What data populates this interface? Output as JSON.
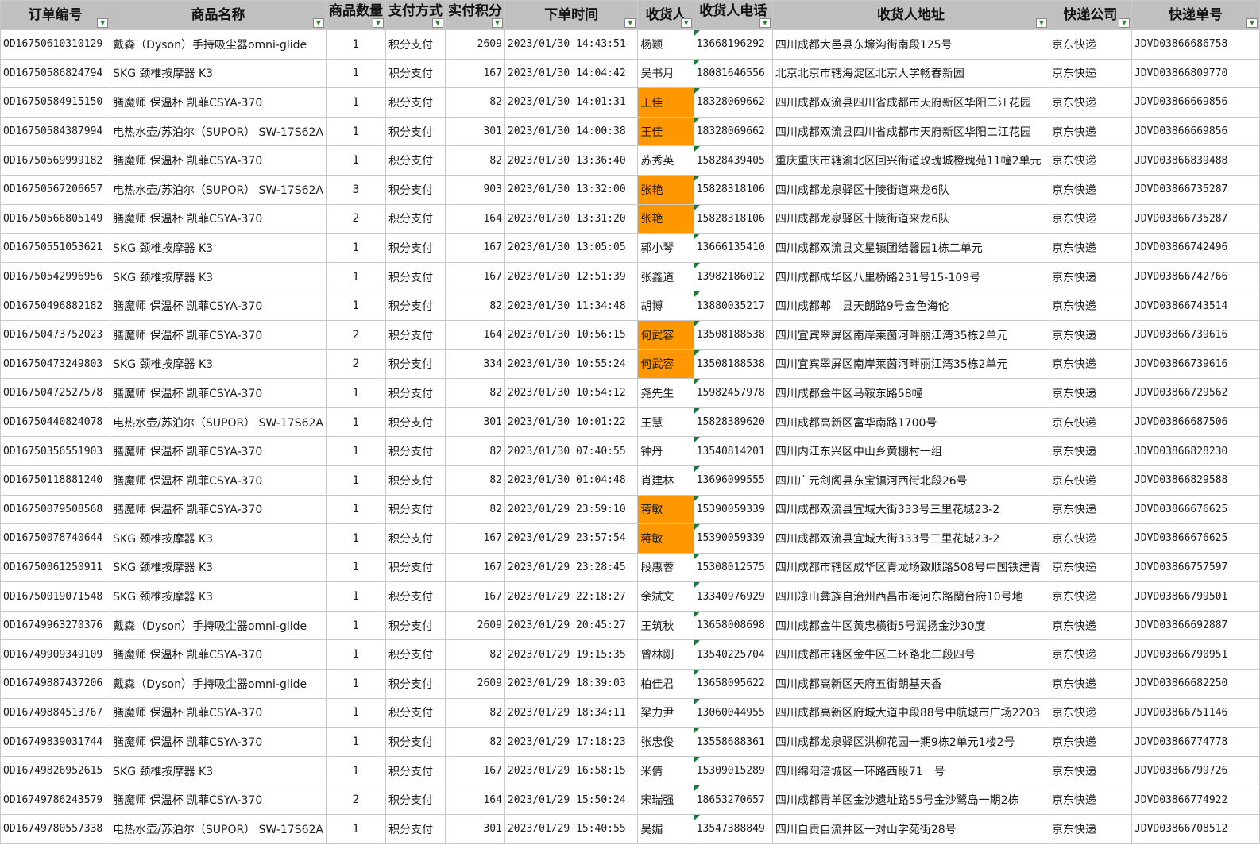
{
  "headers": [
    {
      "label": "订单编号"
    },
    {
      "label": "商品名称"
    },
    {
      "label": "商品数量"
    },
    {
      "label": "支付方式"
    },
    {
      "label": "实付积分"
    },
    {
      "label": "下单时间"
    },
    {
      "label": "收货人"
    },
    {
      "label": "收货人电话"
    },
    {
      "label": "收货人地址"
    },
    {
      "label": "快递公司"
    },
    {
      "label": "快递单号"
    }
  ],
  "highlight_color": "#ff9800",
  "comment_marker_color": "#1b7a3a",
  "filter_icon": "dropdown-filter-icon",
  "rows": [
    {
      "id": "OD16750610310129",
      "product": "戴森（Dyson）手持吸尘器omni-glide",
      "qty": "1",
      "pay": "积分支付",
      "points": "2609",
      "time": "2023/01/30 14:43:51",
      "name": "杨颖",
      "hl": false,
      "phone": "13668196292",
      "addr": "四川成都大邑县东壕沟街南段125号",
      "courier": "京东快递",
      "track": "JDVD03866686758"
    },
    {
      "id": "OD16750586824794",
      "product": "SKG 颈椎按摩器 K3",
      "qty": "1",
      "pay": "积分支付",
      "points": "167",
      "time": "2023/01/30 14:04:42",
      "name": "吴书月",
      "hl": false,
      "phone": "18081646556",
      "addr": "北京北京市辖海淀区北京大学畅春新园",
      "courier": "京东快递",
      "track": "JDVD03866809770"
    },
    {
      "id": "OD16750584915150",
      "product": "膳魔师 保温杯 凯菲CSYA-370",
      "qty": "1",
      "pay": "积分支付",
      "points": "82",
      "time": "2023/01/30 14:01:31",
      "name": "王佳",
      "hl": true,
      "phone": "18328069662",
      "addr": "四川成都双流县四川省成都市天府新区华阳二江花园",
      "courier": "京东快递",
      "track": "JDVD03866669856"
    },
    {
      "id": "OD16750584387994",
      "product": "电热水壶/苏泊尔（SUPOR） SW-17S62A",
      "qty": "1",
      "pay": "积分支付",
      "points": "301",
      "time": "2023/01/30 14:00:38",
      "name": "王佳",
      "hl": true,
      "phone": "18328069662",
      "addr": "四川成都双流县四川省成都市天府新区华阳二江花园",
      "courier": "京东快递",
      "track": "JDVD03866669856"
    },
    {
      "id": "OD16750569999182",
      "product": "膳魔师 保温杯 凯菲CSYA-370",
      "qty": "1",
      "pay": "积分支付",
      "points": "82",
      "time": "2023/01/30 13:36:40",
      "name": "苏秀英",
      "hl": false,
      "phone": "15828439405",
      "addr": "重庆重庆市辖渝北区回兴街道玫瑰城橙瑰苑11幢2单元",
      "courier": "京东快递",
      "track": "JDVD03866839488"
    },
    {
      "id": "OD16750567206657",
      "product": "电热水壶/苏泊尔（SUPOR） SW-17S62A",
      "qty": "3",
      "pay": "积分支付",
      "points": "903",
      "time": "2023/01/30 13:32:00",
      "name": "张艳",
      "hl": true,
      "phone": "15828318106",
      "addr": "四川成都龙泉驿区十陵街道来龙6队",
      "courier": "京东快递",
      "track": "JDVD03866735287"
    },
    {
      "id": "OD16750566805149",
      "product": "膳魔师 保温杯 凯菲CSYA-370",
      "qty": "2",
      "pay": "积分支付",
      "points": "164",
      "time": "2023/01/30 13:31:20",
      "name": "张艳",
      "hl": true,
      "phone": "15828318106",
      "addr": "四川成都龙泉驿区十陵街道来龙6队",
      "courier": "京东快递",
      "track": "JDVD03866735287"
    },
    {
      "id": "OD16750551053621",
      "product": "SKG 颈椎按摩器 K3",
      "qty": "1",
      "pay": "积分支付",
      "points": "167",
      "time": "2023/01/30 13:05:05",
      "name": "郭小琴",
      "hl": false,
      "phone": "13666135410",
      "addr": "四川成都双流县文星镇团结馨园1栋二单元",
      "courier": "京东快递",
      "track": "JDVD03866742496"
    },
    {
      "id": "OD16750542996956",
      "product": "SKG 颈椎按摩器 K3",
      "qty": "1",
      "pay": "积分支付",
      "points": "167",
      "time": "2023/01/30 12:51:39",
      "name": "张鑫道",
      "hl": false,
      "phone": "13982186012",
      "addr": "四川成都成华区八里桥路231号15-109号",
      "courier": "京东快递",
      "track": "JDVD03866742766"
    },
    {
      "id": "OD16750496882182",
      "product": "膳魔师 保温杯 凯菲CSYA-370",
      "qty": "1",
      "pay": "积分支付",
      "points": "82",
      "time": "2023/01/30 11:34:48",
      "name": "胡博",
      "hl": false,
      "phone": "13880035217",
      "addr": "四川成都郫　县天朗路9号金色海伦",
      "courier": "京东快递",
      "track": "JDVD03866743514"
    },
    {
      "id": "OD16750473752023",
      "product": "膳魔师 保温杯 凯菲CSYA-370",
      "qty": "2",
      "pay": "积分支付",
      "points": "164",
      "time": "2023/01/30 10:56:15",
      "name": "何武容",
      "hl": true,
      "phone": "13508188538",
      "addr": "四川宜宾翠屏区南岸莱茵河畔丽江湾35栋2单元",
      "courier": "京东快递",
      "track": "JDVD03866739616"
    },
    {
      "id": "OD16750473249803",
      "product": "SKG 颈椎按摩器 K3",
      "qty": "2",
      "pay": "积分支付",
      "points": "334",
      "time": "2023/01/30 10:55:24",
      "name": "何武容",
      "hl": true,
      "phone": "13508188538",
      "addr": "四川宜宾翠屏区南岸莱茵河畔丽江湾35栋2单元",
      "courier": "京东快递",
      "track": "JDVD03866739616"
    },
    {
      "id": "OD16750472527578",
      "product": "膳魔师 保温杯 凯菲CSYA-370",
      "qty": "1",
      "pay": "积分支付",
      "points": "82",
      "time": "2023/01/30 10:54:12",
      "name": "尧先生",
      "hl": false,
      "phone": "15982457978",
      "addr": "四川成都金牛区马鞍东路58幢",
      "courier": "京东快递",
      "track": "JDVD03866729562"
    },
    {
      "id": "OD16750440824078",
      "product": "电热水壶/苏泊尔（SUPOR） SW-17S62A",
      "qty": "1",
      "pay": "积分支付",
      "points": "301",
      "time": "2023/01/30 10:01:22",
      "name": "王慧",
      "hl": false,
      "phone": "15828389620",
      "addr": "四川成都高新区富华南路1700号",
      "courier": "京东快递",
      "track": "JDVD03866687506"
    },
    {
      "id": "OD16750356551903",
      "product": "膳魔师 保温杯 凯菲CSYA-370",
      "qty": "1",
      "pay": "积分支付",
      "points": "82",
      "time": "2023/01/30 07:40:55",
      "name": "钟丹",
      "hl": false,
      "phone": "13540814201",
      "addr": "四川内江东兴区中山乡黄棚村一组",
      "courier": "京东快递",
      "track": "JDVD03866828230"
    },
    {
      "id": "OD16750118881240",
      "product": "膳魔师 保温杯 凯菲CSYA-370",
      "qty": "1",
      "pay": "积分支付",
      "points": "82",
      "time": "2023/01/30 01:04:48",
      "name": "肖建林",
      "hl": false,
      "phone": "13696099555",
      "addr": "四川广元剑阁县东宝镇河西街北段26号",
      "courier": "京东快递",
      "track": "JDVD03866829588"
    },
    {
      "id": "OD16750079508568",
      "product": "膳魔师 保温杯 凯菲CSYA-370",
      "qty": "1",
      "pay": "积分支付",
      "points": "82",
      "time": "2023/01/29 23:59:10",
      "name": "蒋敏",
      "hl": true,
      "phone": "15390059339",
      "addr": "四川成都双流县宜城大街333号三里花城23-2",
      "courier": "京东快递",
      "track": "JDVD03866676625"
    },
    {
      "id": "OD16750078740644",
      "product": "SKG 颈椎按摩器 K3",
      "qty": "1",
      "pay": "积分支付",
      "points": "167",
      "time": "2023/01/29 23:57:54",
      "name": "蒋敏",
      "hl": true,
      "phone": "15390059339",
      "addr": "四川成都双流县宜城大街333号三里花城23-2",
      "courier": "京东快递",
      "track": "JDVD03866676625"
    },
    {
      "id": "OD16750061250911",
      "product": "SKG 颈椎按摩器 K3",
      "qty": "1",
      "pay": "积分支付",
      "points": "167",
      "time": "2023/01/29 23:28:45",
      "name": "段惠蓉",
      "hl": false,
      "phone": "15308012575",
      "addr": "四川成都市辖区成华区青龙场致顺路508号中国铁建青",
      "courier": "京东快递",
      "track": "JDVD03866757597"
    },
    {
      "id": "OD16750019071548",
      "product": "SKG 颈椎按摩器 K3",
      "qty": "1",
      "pay": "积分支付",
      "points": "167",
      "time": "2023/01/29 22:18:27",
      "name": "余斌文",
      "hl": false,
      "phone": "13340976929",
      "addr": "四川凉山彝族自治州西昌市海河东路蘭台府10号地",
      "courier": "京东快递",
      "track": "JDVD03866799501"
    },
    {
      "id": "OD16749963270376",
      "product": "戴森（Dyson）手持吸尘器omni-glide",
      "qty": "1",
      "pay": "积分支付",
      "points": "2609",
      "time": "2023/01/29 20:45:27",
      "name": "王筑秋",
      "hl": false,
      "phone": "13658008698",
      "addr": "四川成都金牛区黄忠横街5号润扬金沙30度",
      "courier": "京东快递",
      "track": "JDVD03866692887"
    },
    {
      "id": "OD16749909349109",
      "product": "膳魔师 保温杯 凯菲CSYA-370",
      "qty": "1",
      "pay": "积分支付",
      "points": "82",
      "time": "2023/01/29 19:15:35",
      "name": "曾林刚",
      "hl": false,
      "phone": "13540225704",
      "addr": "四川成都市辖区金牛区二环路北二段四号",
      "courier": "京东快递",
      "track": "JDVD03866790951"
    },
    {
      "id": "OD16749887437206",
      "product": "戴森（Dyson）手持吸尘器omni-glide",
      "qty": "1",
      "pay": "积分支付",
      "points": "2609",
      "time": "2023/01/29 18:39:03",
      "name": "柏佳君",
      "hl": false,
      "phone": "13658095622",
      "addr": "四川成都高新区天府五街朗基天香",
      "courier": "京东快递",
      "track": "JDVD03866682250"
    },
    {
      "id": "OD16749884513767",
      "product": "膳魔师 保温杯 凯菲CSYA-370",
      "qty": "1",
      "pay": "积分支付",
      "points": "82",
      "time": "2023/01/29 18:34:11",
      "name": "梁力尹",
      "hl": false,
      "phone": "13060044955",
      "addr": "四川成都高新区府城大道中段88号中航城市广场2203",
      "courier": "京东快递",
      "track": "JDVD03866751146"
    },
    {
      "id": "OD16749839031744",
      "product": "膳魔师 保温杯 凯菲CSYA-370",
      "qty": "1",
      "pay": "积分支付",
      "points": "82",
      "time": "2023/01/29 17:18:23",
      "name": "张忠俊",
      "hl": false,
      "phone": "13558688361",
      "addr": "四川成都龙泉驿区洪柳花园一期9栋2单元1楼2号",
      "courier": "京东快递",
      "track": "JDVD03866774778"
    },
    {
      "id": "OD16749826952615",
      "product": "SKG 颈椎按摩器 K3",
      "qty": "1",
      "pay": "积分支付",
      "points": "167",
      "time": "2023/01/29 16:58:15",
      "name": "米倩",
      "hl": false,
      "phone": "15309015289",
      "addr": "四川绵阳涪城区一环路西段71　号",
      "courier": "京东快递",
      "track": "JDVD03866799726"
    },
    {
      "id": "OD16749786243579",
      "product": "膳魔师 保温杯 凯菲CSYA-370",
      "qty": "2",
      "pay": "积分支付",
      "points": "164",
      "time": "2023/01/29 15:50:24",
      "name": "宋瑞强",
      "hl": false,
      "phone": "18653270657",
      "addr": "四川成都青羊区金沙遗址路55号金沙鹭岛一期2栋",
      "courier": "京东快递",
      "track": "JDVD03866774922"
    },
    {
      "id": "OD16749780557338",
      "product": "电热水壶/苏泊尔（SUPOR） SW-17S62A",
      "qty": "1",
      "pay": "积分支付",
      "points": "301",
      "time": "2023/01/29 15:40:55",
      "name": "吴媚",
      "hl": false,
      "phone": "13547388849",
      "addr": "四川自贡自流井区一对山学苑街28号",
      "courier": "京东快递",
      "track": "JDVD03866708512"
    }
  ]
}
